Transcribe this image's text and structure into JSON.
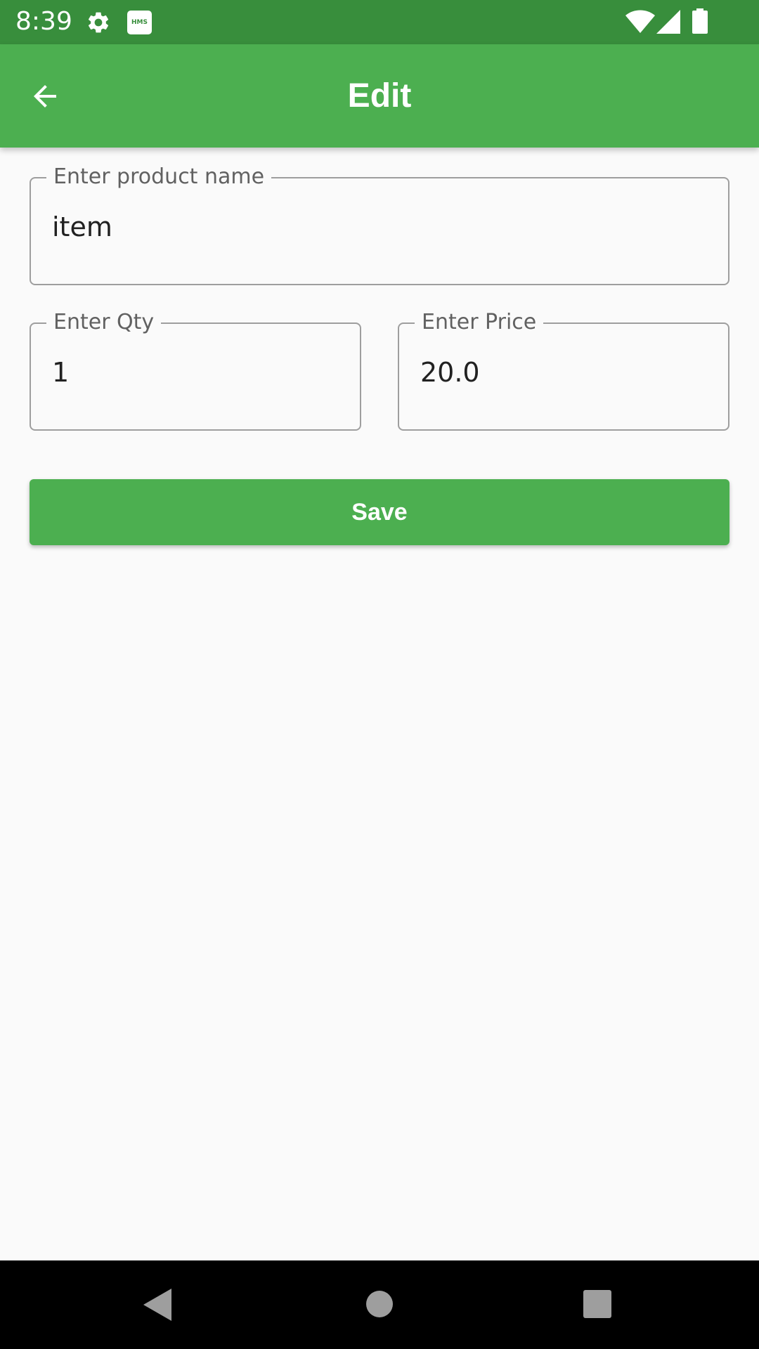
{
  "status_bar": {
    "time": "8:39",
    "notification_icons": [
      "gear-icon",
      "hms-icon"
    ],
    "hms_badge": "HMS",
    "system_icons": [
      "wifi-icon",
      "signal-icon",
      "battery-icon"
    ]
  },
  "app_bar": {
    "title": "Edit",
    "back_icon": "arrow-back-icon"
  },
  "form": {
    "product_name": {
      "label": "Enter product name",
      "value": "item"
    },
    "qty": {
      "label": "Enter Qty",
      "value": "1"
    },
    "price": {
      "label": "Enter Price",
      "value": "20.0"
    },
    "save_label": "Save"
  },
  "nav_bar": {
    "buttons": [
      "back-triangle-icon",
      "home-circle-icon",
      "recents-square-icon"
    ]
  },
  "colors": {
    "status_bar": "#388e3c",
    "app_bar": "#4caf50",
    "button": "#4caf50",
    "field_border": "#9e9e9e",
    "label": "#616161",
    "background": "#fafafa"
  }
}
